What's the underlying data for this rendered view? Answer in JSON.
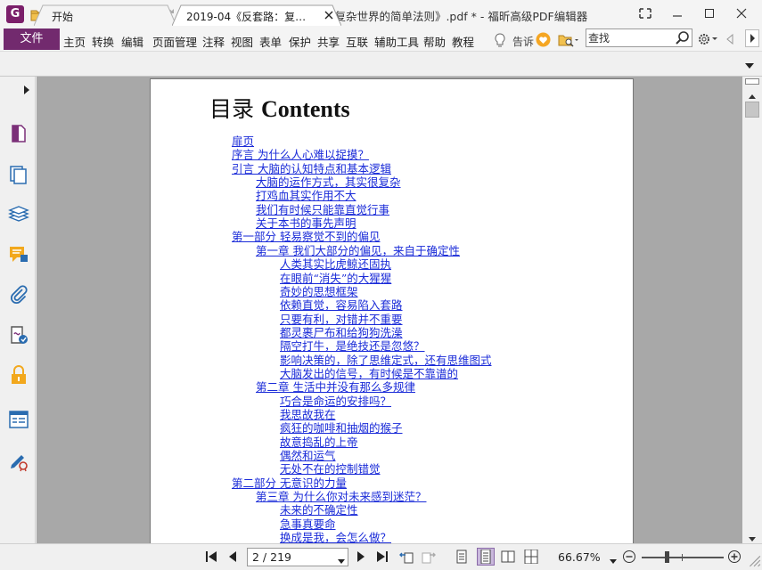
{
  "window": {
    "title": "2019-04《反套路：复杂世界的简单法则》.pdf * - 福昕高级PDF编辑器",
    "logo": "G"
  },
  "quick_access": [
    "open-folder-icon",
    "save-icon",
    "print-icon",
    "email-icon",
    "new-icon",
    "undo-icon",
    "redo-icon",
    "hand-tool-icon"
  ],
  "menu": {
    "file": "文件",
    "items": [
      "主页",
      "转换",
      "编辑",
      "页面管理",
      "注释",
      "视图",
      "表单",
      "保护",
      "共享",
      "互联",
      "辅助工具",
      "帮助",
      "教程"
    ],
    "tell_me": "告诉"
  },
  "search": {
    "placeholder": "查找"
  },
  "tabs": [
    {
      "label": "开始"
    },
    {
      "label": "2019-04《反套路：复…"
    }
  ],
  "left_panel": [
    "page-thumbnail-icon",
    "pages-icon",
    "layers-icon",
    "comments-icon",
    "attachments-icon",
    "signature-icon",
    "security-icon",
    "form-fields-icon",
    "fill-sign-icon"
  ],
  "document": {
    "heading_cn": "目录",
    "heading_en": "Contents",
    "toc": [
      {
        "text": "扉页",
        "level": 0
      },
      {
        "text": "序言 为什么人心难以捉摸？",
        "level": 0
      },
      {
        "text": "引言 大脑的认知特点和基本逻辑",
        "level": 0
      },
      {
        "text": "大脑的运作方式，其实很复杂",
        "level": 1
      },
      {
        "text": "打鸡血其实作用不大",
        "level": 1
      },
      {
        "text": "我们有时候只能靠直觉行事",
        "level": 1
      },
      {
        "text": "关于本书的事先声明",
        "level": 1
      },
      {
        "text": "第一部分 轻易察觉不到的偏见",
        "level": 0
      },
      {
        "text": "第一章 我们大部分的偏见，来自于确定性",
        "level": 1
      },
      {
        "text": "人类其实比虎鲸还固执",
        "level": 2
      },
      {
        "text": "在眼前“消失”的大猩猩",
        "level": 2
      },
      {
        "text": "奇妙的思想框架",
        "level": 2
      },
      {
        "text": "依赖直觉，容易陷入套路",
        "level": 2
      },
      {
        "text": "只要有利，对错并不重要",
        "level": 2
      },
      {
        "text": "都灵裹尸布和给狗狗洗澡",
        "level": 2
      },
      {
        "text": "隔空打牛，是绝技还是忽悠？",
        "level": 2
      },
      {
        "text": "影响决策的，除了思维定式，还有思维图式",
        "level": 2
      },
      {
        "text": "大脑发出的信号，有时候是不靠谱的",
        "level": 2
      },
      {
        "text": "第二章 生活中并没有那么多规律",
        "level": 1
      },
      {
        "text": "巧合是命运的安排吗？",
        "level": 2
      },
      {
        "text": "我思故我在",
        "level": 2
      },
      {
        "text": "疯狂的咖啡和抽烟的猴子",
        "level": 2
      },
      {
        "text": "故意捣乱的上帝",
        "level": 2
      },
      {
        "text": "偶然和运气",
        "level": 2
      },
      {
        "text": "无处不在的控制错觉",
        "level": 2
      },
      {
        "text": "第二部分 无意识的力量",
        "level": 0
      },
      {
        "text": "第三章 为什么你对未来感到迷茫？",
        "level": 1
      },
      {
        "text": "未来的不确定性",
        "level": 2
      },
      {
        "text": "急事真要命",
        "level": 2
      },
      {
        "text": "换成是我，会怎么做？",
        "level": 2
      }
    ]
  },
  "status": {
    "page_display": "2 / 219",
    "zoom": "66.67%",
    "zoom_fraction": 0.3
  },
  "colors": {
    "accent": "#722a6e",
    "link": "#1a2bd8",
    "canvas": "#a8a8a8"
  }
}
